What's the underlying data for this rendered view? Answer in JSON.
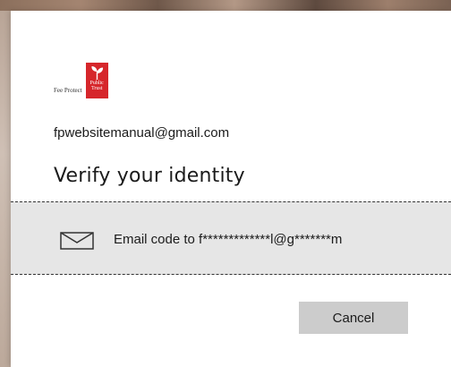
{
  "brand": {
    "tagline": "Fee Protect",
    "logo_line1": "Public",
    "logo_line2": "Trust",
    "logo_color": "#d6262b"
  },
  "account": {
    "email": "fpwebsitemanual@gmail.com"
  },
  "heading": {
    "title": "Verify your identity"
  },
  "options": [
    {
      "icon": "envelope-icon",
      "label": "Email code to f*************l@g*******m"
    }
  ],
  "actions": {
    "cancel_label": "Cancel"
  },
  "colors": {
    "option_bg": "#e6e6e6",
    "button_bg": "#cccccc",
    "text": "#1b1b1b"
  }
}
